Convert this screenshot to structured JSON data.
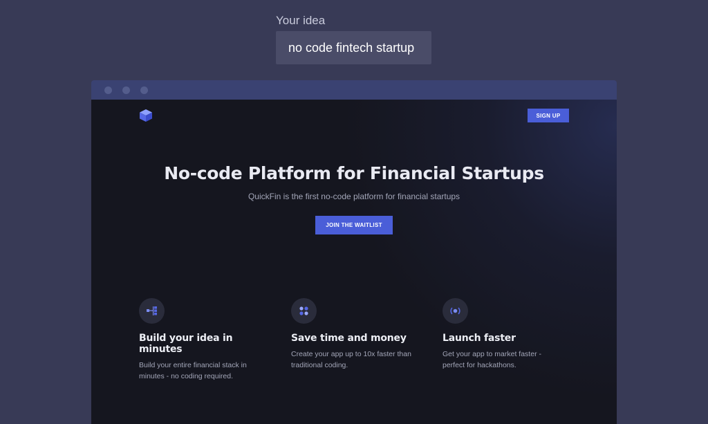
{
  "prompt": {
    "label": "Your idea",
    "value": "no code fintech startup"
  },
  "site": {
    "nav": {
      "logo_icon": "cube-logo-icon",
      "signup_label": "SIGN UP"
    },
    "hero": {
      "title": "No-code Platform for Financial Startups",
      "subtitle": "QuickFin is the first no-code platform for financial startups",
      "cta_label": "JOIN THE WAITLIST"
    },
    "features": [
      {
        "icon": "flow-blocks-icon",
        "title": "Build your idea in minutes",
        "description": "Build your entire financial stack in minutes - no coding required."
      },
      {
        "icon": "dots-grid-icon",
        "title": "Save time and money",
        "description": "Create your app up to 10x faster than traditional coding."
      },
      {
        "icon": "radio-signal-icon",
        "title": "Launch faster",
        "description": "Get your app to market faster - perfect for hackathons."
      }
    ]
  },
  "colors": {
    "page_background": "#383a56",
    "browser_bar": "#3a4272",
    "site_background": "#15161f",
    "accent": "#4a5ed8"
  }
}
